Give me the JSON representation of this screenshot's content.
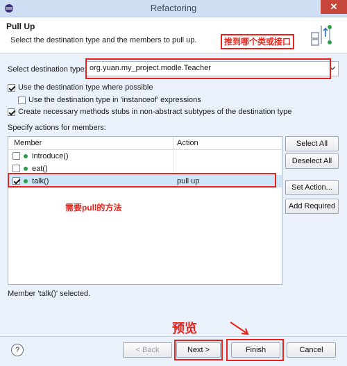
{
  "window": {
    "title": "Refactoring",
    "close_glyph": "✕"
  },
  "header": {
    "title": "Pull Up",
    "description": "Select the destination type and the members to pull up.",
    "annotation": "推到哪个类或接口"
  },
  "destination": {
    "label": "Select destination type:",
    "value": "org.yuan.my_project.modle.Teacher"
  },
  "options": {
    "use_destination": "Use the destination type where possible",
    "use_instanceof": "Use the destination type in 'instanceof' expressions",
    "create_stubs": "Create necessary methods stubs in non-abstract subtypes of the destination type"
  },
  "members_section": {
    "label": "Specify actions for members:",
    "columns": [
      "Member",
      "Action"
    ],
    "rows": [
      {
        "member": "introduce()",
        "action": "",
        "checked": false
      },
      {
        "member": "eat()",
        "action": "",
        "checked": false
      },
      {
        "member": "talk()",
        "action": "pull up",
        "checked": true
      }
    ],
    "annotation": "需要pull的方法"
  },
  "side_buttons": {
    "select_all": "Select All",
    "deselect_all": "Deselect All",
    "set_action": "Set Action...",
    "add_required": "Add Required"
  },
  "status": "Member 'talk()' selected.",
  "footer": {
    "help": "?",
    "back": "< Back",
    "next": "Next >",
    "finish": "Finish",
    "cancel": "Cancel",
    "preview_annotation": "预览"
  }
}
